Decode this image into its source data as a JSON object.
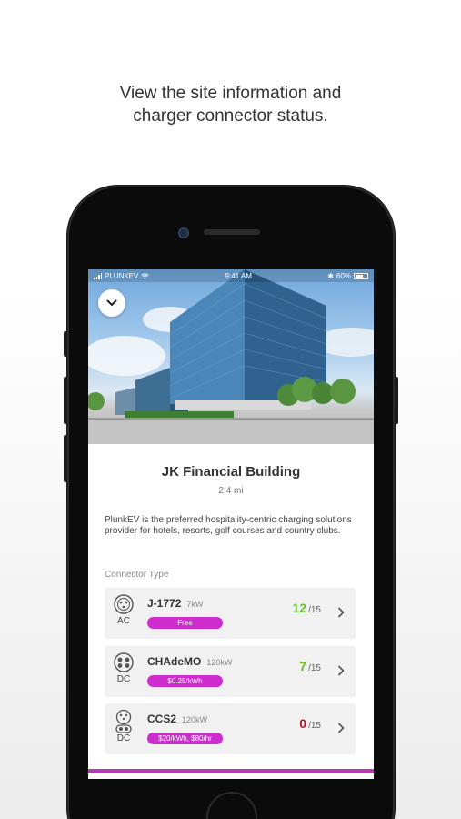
{
  "caption": {
    "line1": "View the site information and",
    "line2": "charger connector status."
  },
  "status_bar": {
    "carrier": "PLUNKEV",
    "time": "9:41 AM",
    "battery": "60%"
  },
  "site": {
    "name": "JK Financial Building",
    "distance": "2.4 mi",
    "description": "PlunkEV is the preferred hospitality-centric charging solutions provider for hotels, resorts, golf courses and country clubs."
  },
  "connectors": {
    "section_label": "Connector Type",
    "items": [
      {
        "name": "J-1772",
        "power": "7kW",
        "current": "AC",
        "price": "Free",
        "available": "12",
        "total": "/15",
        "available_color": "#6bbf2c",
        "icon": "j1772-plug-icon"
      },
      {
        "name": "CHAdeMO",
        "power": "120kW",
        "current": "DC",
        "price": "$0.25/kWh",
        "available": "7",
        "total": "/15",
        "available_color": "#6bbf2c",
        "icon": "chademo-plug-icon"
      },
      {
        "name": "CCS2",
        "power": "120kW",
        "current": "DC",
        "price": "$20/kWh, $80/hr",
        "available": "0",
        "total": "/15",
        "available_color": "#b0142a",
        "icon": "ccs2-plug-icon"
      }
    ]
  },
  "colors": {
    "accent": "#cc2dcc",
    "available_green": "#6bbf2c",
    "unavailable_red": "#b0142a"
  }
}
